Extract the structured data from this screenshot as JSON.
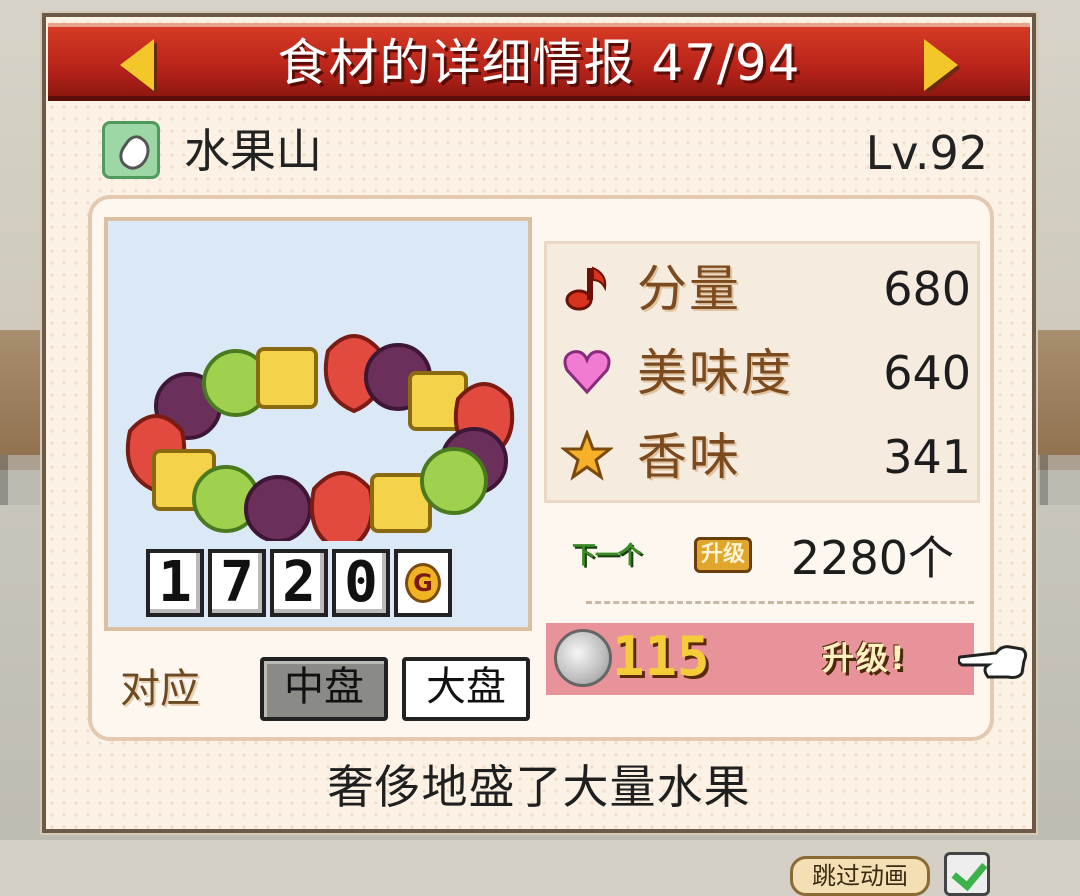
{
  "header": {
    "title": "食材的详细情报 47/94"
  },
  "item": {
    "name": "水果山",
    "level": "Lv.92",
    "icon": "ingredient-icon",
    "description": "奢侈地盛了大量水果"
  },
  "price": {
    "digits": [
      "1",
      "7",
      "2",
      "0"
    ],
    "currency": "G"
  },
  "compatibility": {
    "label": "对应",
    "plates": [
      "中盘",
      "大盘"
    ],
    "selected": "中盘"
  },
  "stats": [
    {
      "icon": "music-note-icon",
      "label": "分量",
      "value": "680"
    },
    {
      "icon": "heart-icon",
      "label": "美味度",
      "value": "640"
    },
    {
      "icon": "star-icon",
      "label": "香味",
      "value": "341"
    }
  ],
  "next_level": {
    "tag": "下一个",
    "levelup_tag": "升级",
    "count": "2280个"
  },
  "upgrade": {
    "cost": "115",
    "button": "升级!"
  },
  "footer": {
    "skip_label": "跳过动画"
  },
  "colors": {
    "header": "#c22a1d",
    "accent_gold": "#f3c62a",
    "upgrade_bar": "#e8939a"
  }
}
